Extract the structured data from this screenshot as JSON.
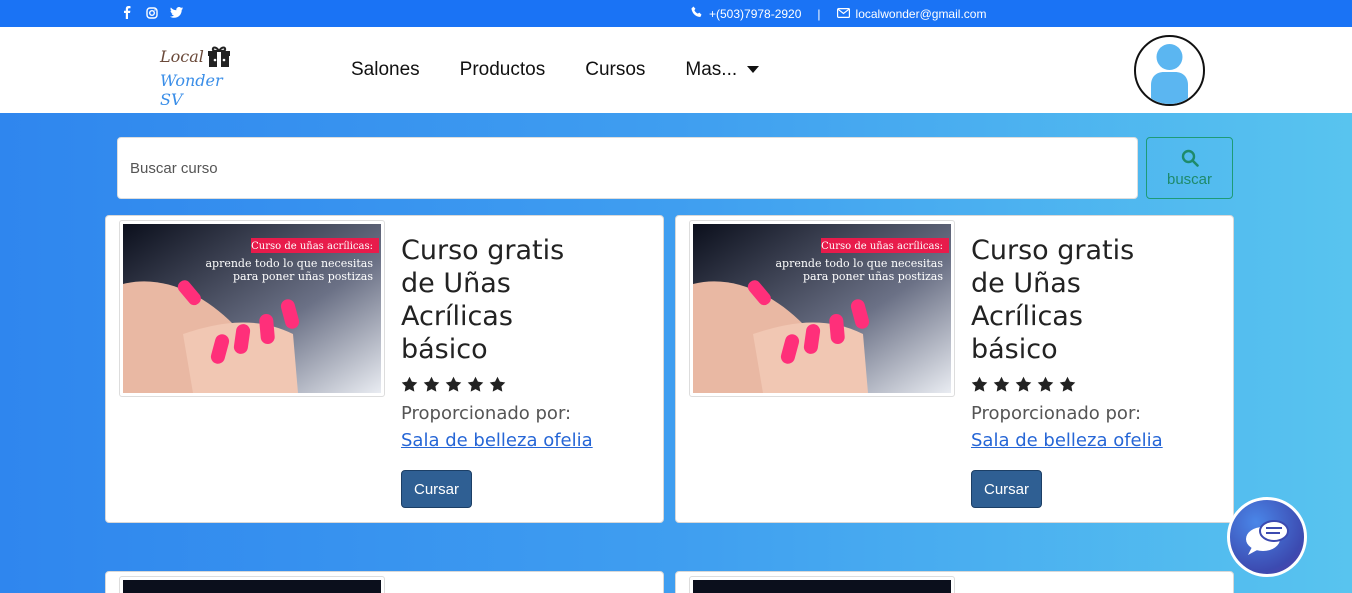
{
  "topbar": {
    "phone": "+(503)7978-2920",
    "separator": "|",
    "email": "localwonder@gmail.com",
    "social_icons": [
      "facebook-icon",
      "instagram-icon",
      "twitter-icon"
    ]
  },
  "brand": {
    "line1": "Local",
    "line2": "Wonder SV"
  },
  "nav": {
    "items": [
      "Salones",
      "Productos",
      "Cursos",
      "Mas..."
    ]
  },
  "search": {
    "placeholder": "Buscar curso",
    "button_label": "buscar"
  },
  "courses": [
    {
      "title": "Curso gratis de Uñas Acrílicas básico",
      "rating": 5,
      "provided_label": "Proporcionado por:",
      "provider": "Sala de belleza ofelia",
      "button_label": "Cursar",
      "image_banner": "Curso de uñas acrílicas:",
      "image_text_1": "aprende todo lo que necesitas",
      "image_text_2": "para poner uñas postizas"
    },
    {
      "title": "Curso gratis de Uñas Acrílicas básico",
      "rating": 5,
      "provided_label": "Proporcionado por:",
      "provider": "Sala de belleza ofelia",
      "button_label": "Cursar",
      "image_banner": "Curso de uñas acrílicas:",
      "image_text_1": "aprende todo lo que necesitas",
      "image_text_2": "para poner uñas postizas"
    }
  ],
  "colors": {
    "topbar": "#1a73f5",
    "gradient_start": "#2f86ee",
    "gradient_end": "#58c4ef",
    "button": "#2f5f93",
    "link": "#2666d6",
    "search_button": "#1e8a6b"
  }
}
